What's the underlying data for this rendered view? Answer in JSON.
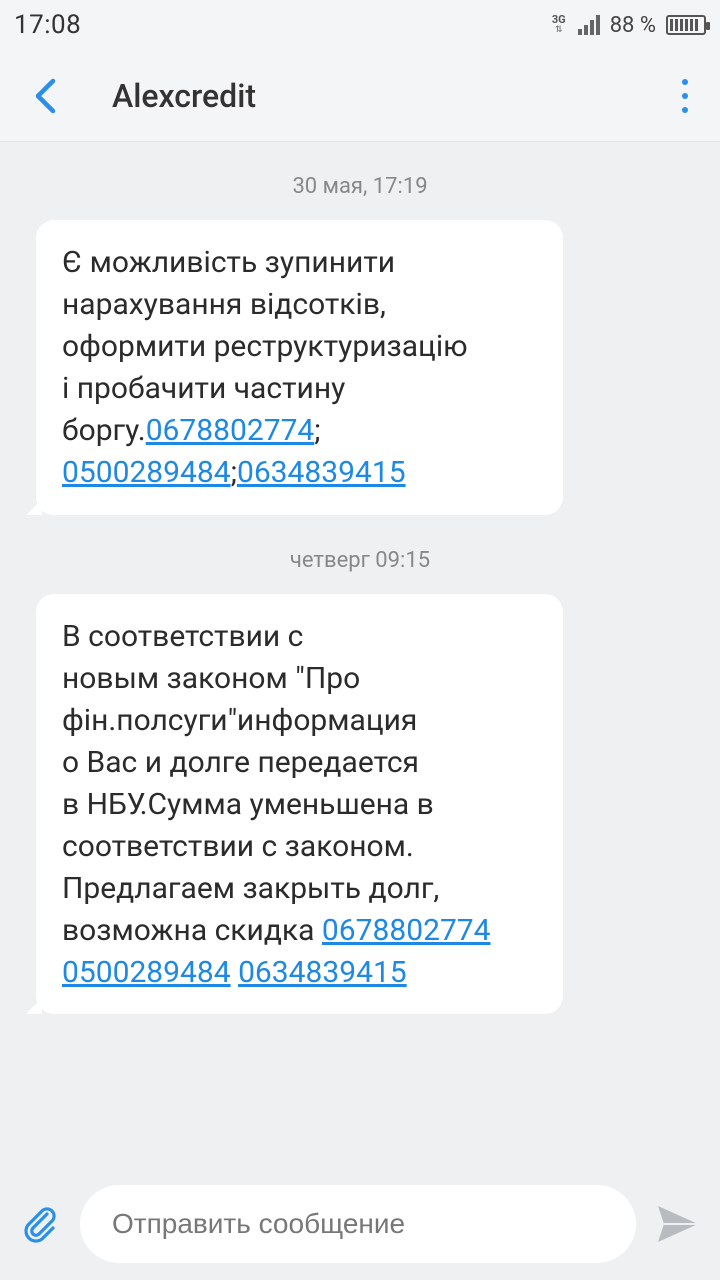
{
  "status_bar": {
    "time": "17:08",
    "network": "3G",
    "battery_percent": "88 %",
    "battery_level": 0.88
  },
  "header": {
    "title": "Alexcredit",
    "back_icon": "chevron-left-icon",
    "menu_icon": "more-vertical-icon"
  },
  "messages": [
    {
      "timestamp": "30 мая, 17:19",
      "segments": [
        {
          "text": "Є можливість зупинити",
          "link": false
        },
        {
          "text": "\n",
          "link": false
        },
        {
          "text": "нарахування відсотків,",
          "link": false
        },
        {
          "text": "\n",
          "link": false
        },
        {
          "text": "оформити реструктуризацію",
          "link": false
        },
        {
          "text": "\n",
          "link": false
        },
        {
          "text": "і пробачити частину",
          "link": false
        },
        {
          "text": "\n",
          "link": false
        },
        {
          "text": "боргу.",
          "link": false
        },
        {
          "text": "0678802774",
          "link": true
        },
        {
          "text": ";",
          "link": false
        },
        {
          "text": "\n",
          "link": false
        },
        {
          "text": "0500289484",
          "link": true
        },
        {
          "text": ";",
          "link": false
        },
        {
          "text": "0634839415",
          "link": true
        }
      ]
    },
    {
      "timestamp": "четверг 09:15",
      "segments": [
        {
          "text": "В соответствии с",
          "link": false
        },
        {
          "text": "\n",
          "link": false
        },
        {
          "text": "новым законом \"Про",
          "link": false
        },
        {
          "text": "\n",
          "link": false
        },
        {
          "text": "фін.полсуги\"информация",
          "link": false
        },
        {
          "text": "\n",
          "link": false
        },
        {
          "text": "о Вас и долге передается",
          "link": false
        },
        {
          "text": "\n",
          "link": false
        },
        {
          "text": "в НБУ.Сумма уменьшена в",
          "link": false
        },
        {
          "text": "\n",
          "link": false
        },
        {
          "text": "соответствии с законом.",
          "link": false
        },
        {
          "text": "\n",
          "link": false
        },
        {
          "text": "Предлагаем закрыть долг,",
          "link": false
        },
        {
          "text": "\n",
          "link": false
        },
        {
          "text": "возможна скидка ",
          "link": false
        },
        {
          "text": "0678802774",
          "link": true
        },
        {
          "text": "\n",
          "link": false
        },
        {
          "text": "0500289484",
          "link": true
        },
        {
          "text": " ",
          "link": false
        },
        {
          "text": "0634839415",
          "link": true
        }
      ]
    }
  ],
  "composer": {
    "placeholder": "Отправить сообщение",
    "attach_icon": "paperclip-icon",
    "send_icon": "send-icon"
  },
  "colors": {
    "accent": "#2b8fe8",
    "link": "#1e88e5",
    "background": "#eef0f2",
    "bubble": "#ffffff"
  }
}
